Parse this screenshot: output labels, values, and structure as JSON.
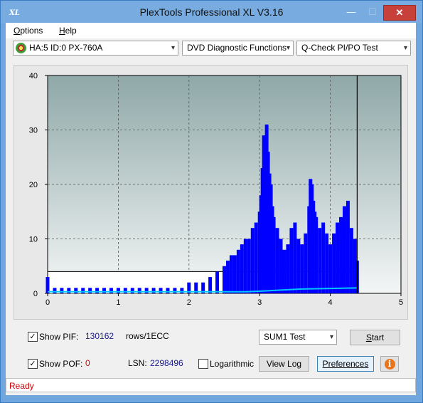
{
  "window": {
    "title": "PlexTools Professional XL V3.16",
    "app_icon_text": "XL",
    "min_glyph": "—",
    "max_glyph": "☐",
    "close_glyph": "✕"
  },
  "menu": {
    "items": [
      {
        "label": "Options",
        "underline": "O"
      },
      {
        "label": "Help",
        "underline": "H"
      }
    ]
  },
  "toolbar": {
    "drive": "HA:5 ID:0  PX-760A",
    "function": "DVD Diagnostic Functions",
    "test": "Q-Check PI/PO Test",
    "arrow_glyph": "▾"
  },
  "chart_data": {
    "type": "bar",
    "xlim": [
      0,
      5
    ],
    "ylim": [
      0,
      40
    ],
    "x_ticks": [
      "0",
      "1",
      "2",
      "3",
      "4",
      "5"
    ],
    "y_ticks": [
      "0",
      "10",
      "20",
      "30",
      "40"
    ],
    "grid": true,
    "end_marker_x": 4.38,
    "threshold_y": 4,
    "series": [
      {
        "kind": "pi_errors",
        "color": "#0000ff",
        "x": [
          0.0,
          0.1,
          0.2,
          0.3,
          0.4,
          0.5,
          0.6,
          0.7,
          0.8,
          0.9,
          1.0,
          1.1,
          1.2,
          1.3,
          1.4,
          1.5,
          1.6,
          1.7,
          1.8,
          1.9,
          2.0,
          2.1,
          2.2,
          2.3,
          2.4,
          2.5,
          2.55,
          2.6,
          2.65,
          2.7,
          2.75,
          2.8,
          2.85,
          2.9,
          2.95,
          3.0,
          3.02,
          3.04,
          3.06,
          3.08,
          3.1,
          3.12,
          3.14,
          3.16,
          3.18,
          3.2,
          3.25,
          3.3,
          3.35,
          3.4,
          3.45,
          3.5,
          3.55,
          3.6,
          3.65,
          3.7,
          3.72,
          3.74,
          3.76,
          3.78,
          3.8,
          3.85,
          3.9,
          3.95,
          4.0,
          4.05,
          4.1,
          4.15,
          4.2,
          4.25,
          4.3,
          4.35,
          4.38
        ],
        "values": [
          3,
          1,
          1,
          1,
          1,
          1,
          1,
          1,
          1,
          1,
          1,
          1,
          1,
          1,
          1,
          1,
          1,
          1,
          1,
          1,
          2,
          2,
          2,
          3,
          4,
          5,
          6,
          7,
          7,
          8,
          9,
          10,
          10,
          12,
          13,
          15,
          18,
          23,
          29,
          24,
          31,
          26,
          22,
          20,
          16,
          14,
          12,
          10,
          8,
          9,
          12,
          13,
          10,
          9,
          11,
          16,
          21,
          20,
          17,
          15,
          14,
          12,
          13,
          11,
          9,
          11,
          13,
          14,
          16,
          17,
          12,
          10,
          6
        ]
      },
      {
        "kind": "pi_average",
        "color": "#00c8ff",
        "x": [
          0.0,
          0.5,
          1.0,
          1.5,
          2.0,
          2.5,
          2.8,
          3.0,
          3.3,
          3.6,
          4.0,
          4.38
        ],
        "values": [
          0.3,
          0.3,
          0.3,
          0.3,
          0.3,
          0.3,
          0.3,
          0.4,
          0.6,
          0.8,
          0.9,
          1.0
        ]
      }
    ]
  },
  "controls": {
    "show_pif_label": "Show PIF:",
    "show_pif_underline": "F",
    "show_pif_checked": true,
    "pif_value": "130162",
    "pif_unit": "rows/1ECC",
    "show_pof_label": "Show POF:",
    "show_pof_underline": "F",
    "show_pof_checked": true,
    "pof_value": "0",
    "lsn_label": "LSN:",
    "lsn_value": "2298496",
    "logarithmic_label": "Logarithmic",
    "logarithmic_checked": false,
    "sum_select": "SUM1 Test",
    "start_label": "Start",
    "view_log_label": "View Log",
    "preferences_label": "Preferences",
    "info_glyph": "i"
  },
  "status": {
    "text": "Ready",
    "color": "#d00000"
  }
}
